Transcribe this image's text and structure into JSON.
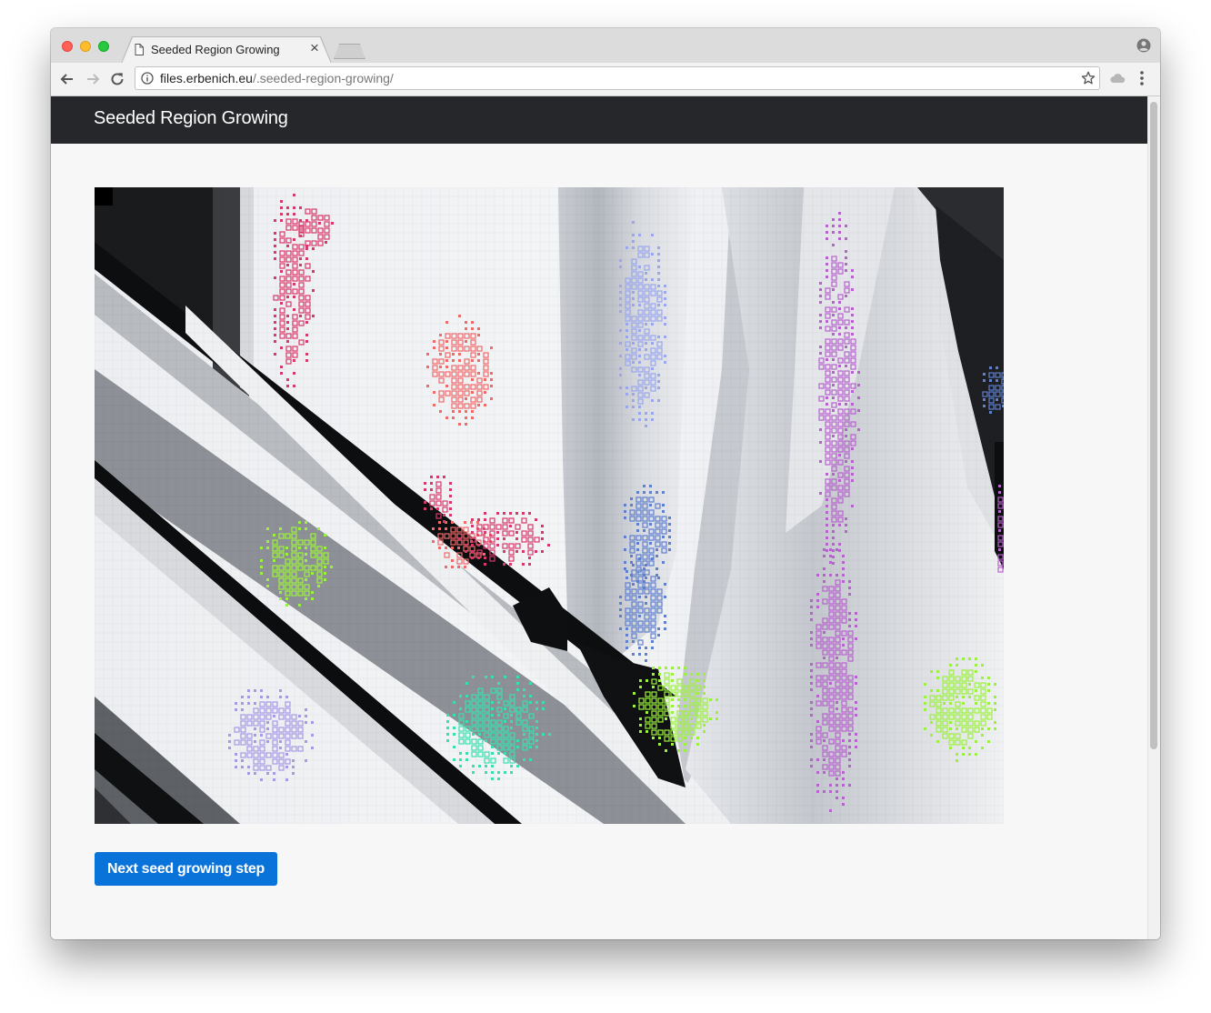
{
  "browser": {
    "tab_title": "Seeded Region Growing",
    "tab_close": "×",
    "url_host": "files.erbenich.eu",
    "url_path": "/.seeded-region-growing/"
  },
  "page": {
    "brand": "Seeded Region Growing",
    "next_button_label": "Next seed growing step"
  },
  "icons": {
    "back": "back-arrow-icon",
    "forward": "forward-arrow-icon",
    "reload": "reload-icon",
    "info": "info-icon",
    "star": "star-icon",
    "extension": "cloud-icon",
    "menu": "kebab-menu-icon",
    "profile": "profile-icon",
    "page": "document-icon"
  },
  "colors": {
    "navbar": "#25272a",
    "button": "#0a73d9",
    "regions": [
      "#d9386a",
      "#f06a6a",
      "#9aa7ee",
      "#b862cf",
      "#9bf23c",
      "#38e0b0",
      "#f5b9a8",
      "#a69ae6",
      "#5f7fcf"
    ]
  }
}
